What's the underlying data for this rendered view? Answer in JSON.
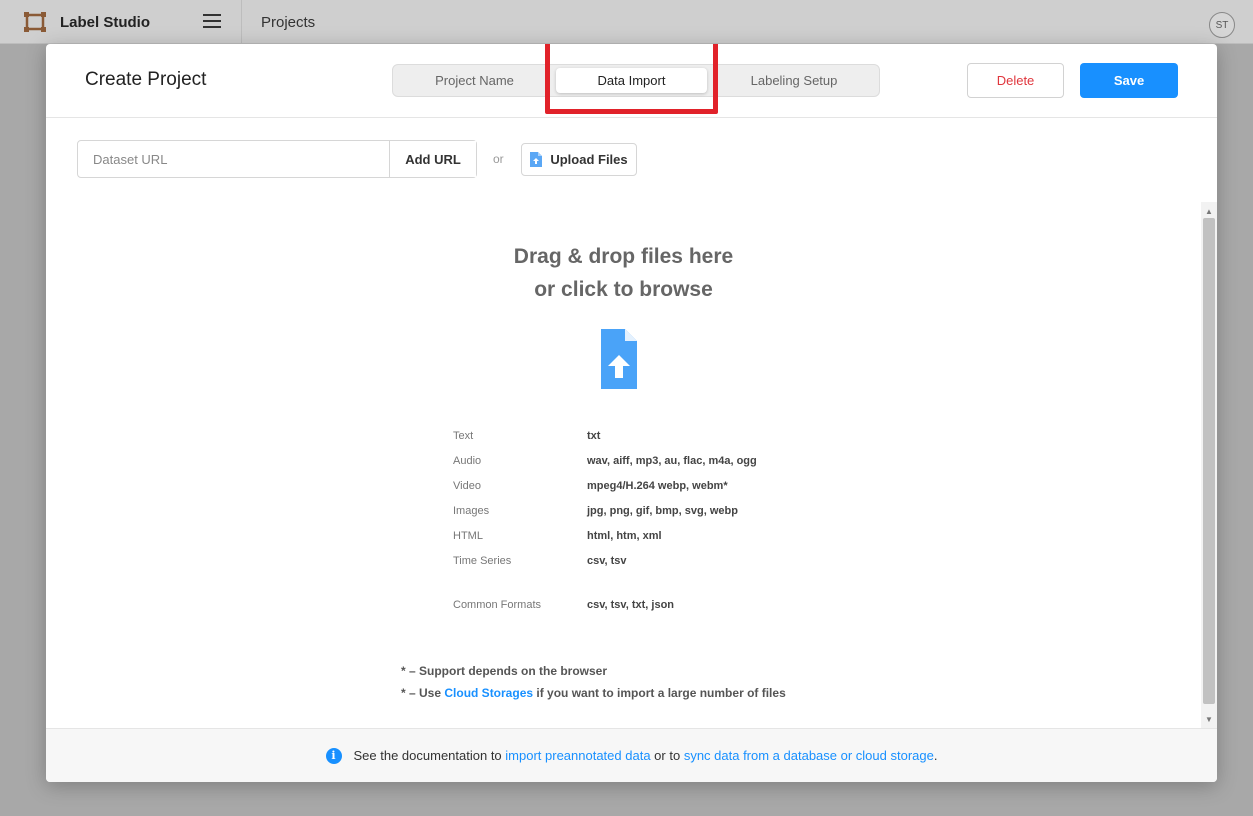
{
  "app": {
    "title": "Label Studio",
    "breadcrumb": "Projects",
    "avatar_initials": "ST"
  },
  "modal": {
    "title": "Create Project",
    "steps": [
      "Project Name",
      "Data Import",
      "Labeling Setup"
    ],
    "active_step": "Data Import",
    "delete_label": "Delete",
    "save_label": "Save"
  },
  "import": {
    "url_placeholder": "Dataset URL",
    "add_url_label": "Add URL",
    "or_label": "or",
    "upload_label": "Upload Files"
  },
  "dropzone": {
    "title_line1": "Drag & drop files here",
    "title_line2": "or click to browse",
    "formats": [
      {
        "type": "Text",
        "ext": "txt"
      },
      {
        "type": "Audio",
        "ext": "wav, aiff, mp3, au, flac, m4a, ogg"
      },
      {
        "type": "Video",
        "ext": "mpeg4/H.264 webp, webm*"
      },
      {
        "type": "Images",
        "ext": "jpg, png, gif, bmp, svg, webp"
      },
      {
        "type": "HTML",
        "ext": "html, htm, xml"
      },
      {
        "type": "Time Series",
        "ext": "csv, tsv"
      },
      {
        "type": "Common Formats",
        "ext": "csv, tsv, txt, json"
      }
    ],
    "note1": "* – Support depends on the browser",
    "note2_prefix": "* – Use ",
    "note2_link": "Cloud Storages",
    "note2_suffix": " if you want to import a large number of files"
  },
  "footer": {
    "text1": "See the documentation to ",
    "link1": "import preannotated data",
    "text2": " or to ",
    "link2": "sync data from a database or cloud storage",
    "text3": "."
  },
  "colors": {
    "accent": "#1890ff",
    "danger": "#e0363d",
    "highlight": "#e1222a"
  }
}
